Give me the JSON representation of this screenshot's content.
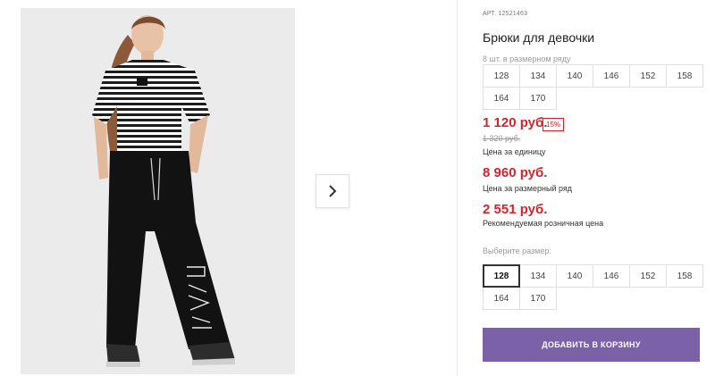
{
  "product": {
    "article_label": "АРТ.",
    "article_value": "12521463",
    "title": "Брюки для девочки",
    "pack_note": "8 шт. в размерном ряду",
    "pack_sizes": [
      "128",
      "134",
      "140",
      "146",
      "152",
      "158",
      "164",
      "170"
    ],
    "price_current": "1 120 руб.",
    "discount_badge": "15%",
    "price_old": "1 320 руб.",
    "price_unit_label": "Цена за единицу",
    "price_pack": "8 960 руб.",
    "price_pack_label": "Цена за размерный ряд",
    "price_retail": "2 551 руб.",
    "price_retail_label": "Рекомендуемая розничная цена",
    "choose_size_label": "Выберите размер:",
    "select_sizes": [
      "128",
      "134",
      "140",
      "146",
      "152",
      "158",
      "164",
      "170"
    ],
    "selected_size": "128",
    "add_to_cart": "ДОБАВИТЬ В КОРЗИНУ"
  },
  "colors": {
    "price_red": "#d8232a",
    "cart_button": "#7b61a8"
  },
  "icons": {
    "next": "chevron-right-icon",
    "image": "product-photo"
  }
}
